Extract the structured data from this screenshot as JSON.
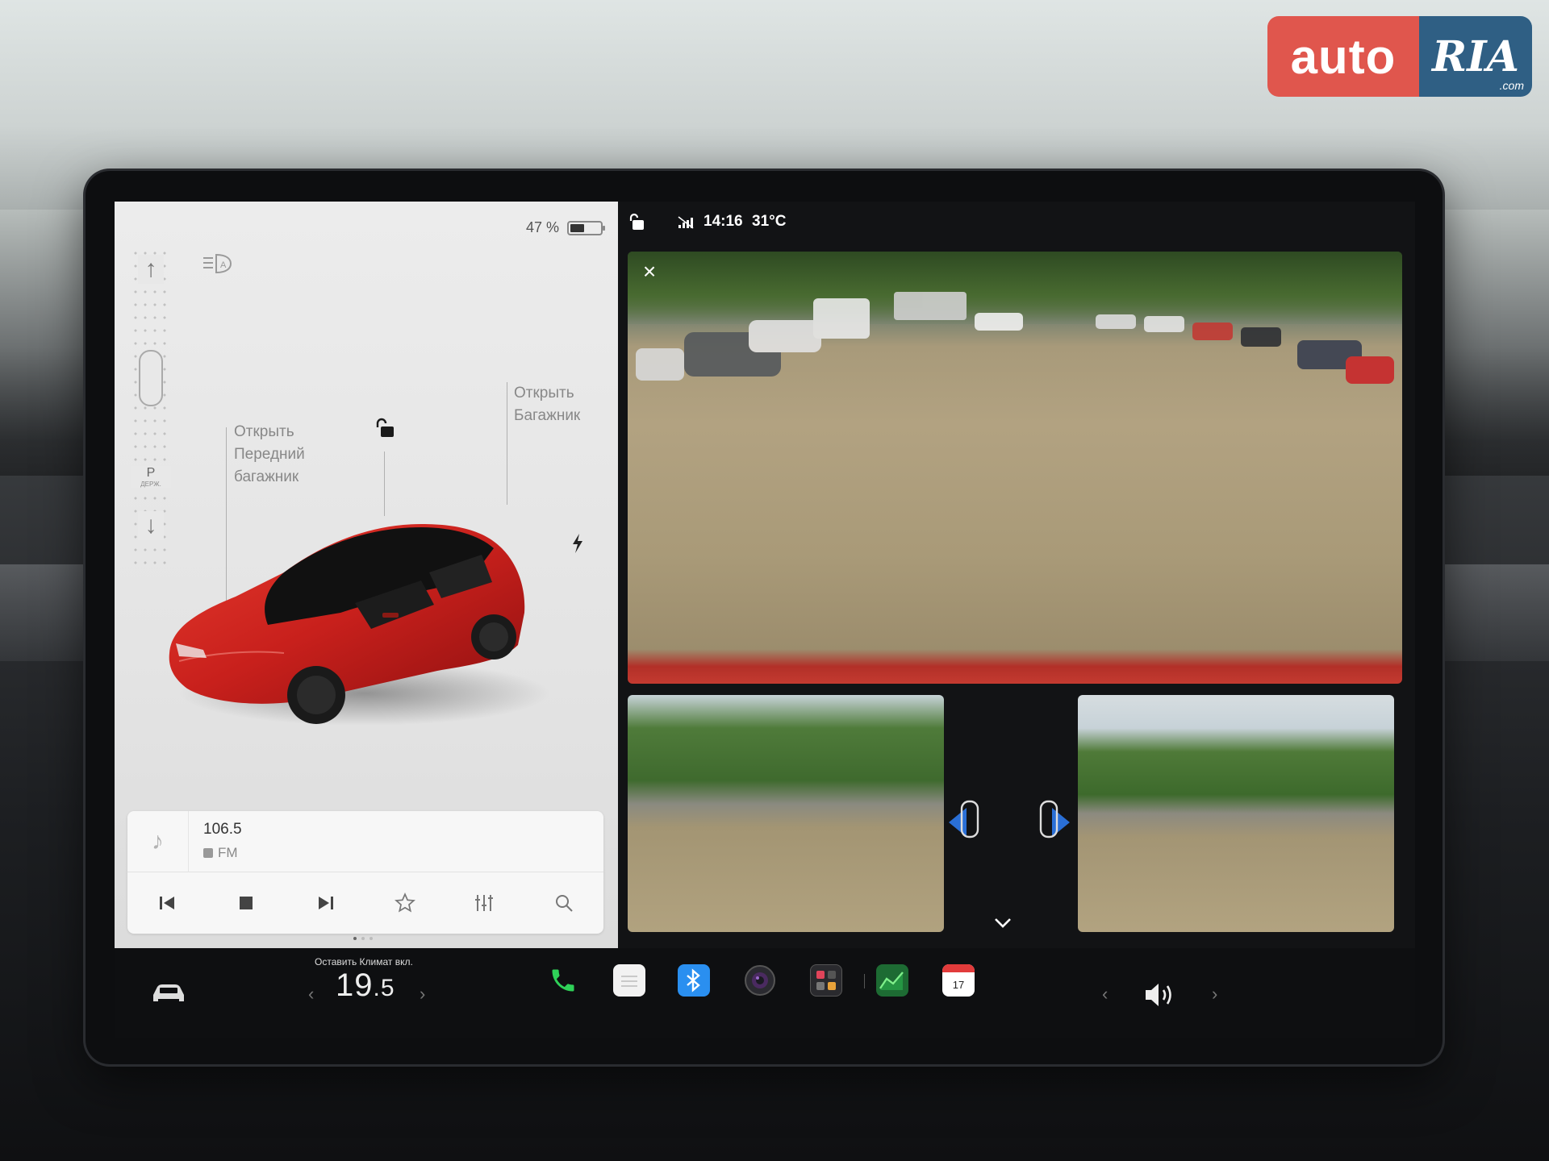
{
  "watermark": {
    "auto": "auto",
    "ria": "RIA",
    "com": ".com"
  },
  "left": {
    "battery_percent": "47 %",
    "battery_level": 0.47,
    "gear": {
      "p": "P",
      "hold": "ДЕРЖ."
    },
    "callouts": {
      "front_trunk": "Открыть\nПередний\nбагажник",
      "rear_trunk": "Открыть\nБагажник"
    },
    "media": {
      "frequency": "106.5",
      "band": "FM"
    }
  },
  "status": {
    "time": "14:16",
    "temperature": "31°C"
  },
  "taskbar": {
    "climate_caption": "Оставить Климат вкл.",
    "temp_main": "19",
    "temp_decimal": ".5",
    "calendar_day": "17"
  },
  "colors": {
    "car_red": "#c8201c",
    "phone_green": "#2fd158",
    "bluetooth_blue": "#2a8ff0",
    "calendar_red": "#e23b3b",
    "energy_green": "#2aa84a"
  }
}
